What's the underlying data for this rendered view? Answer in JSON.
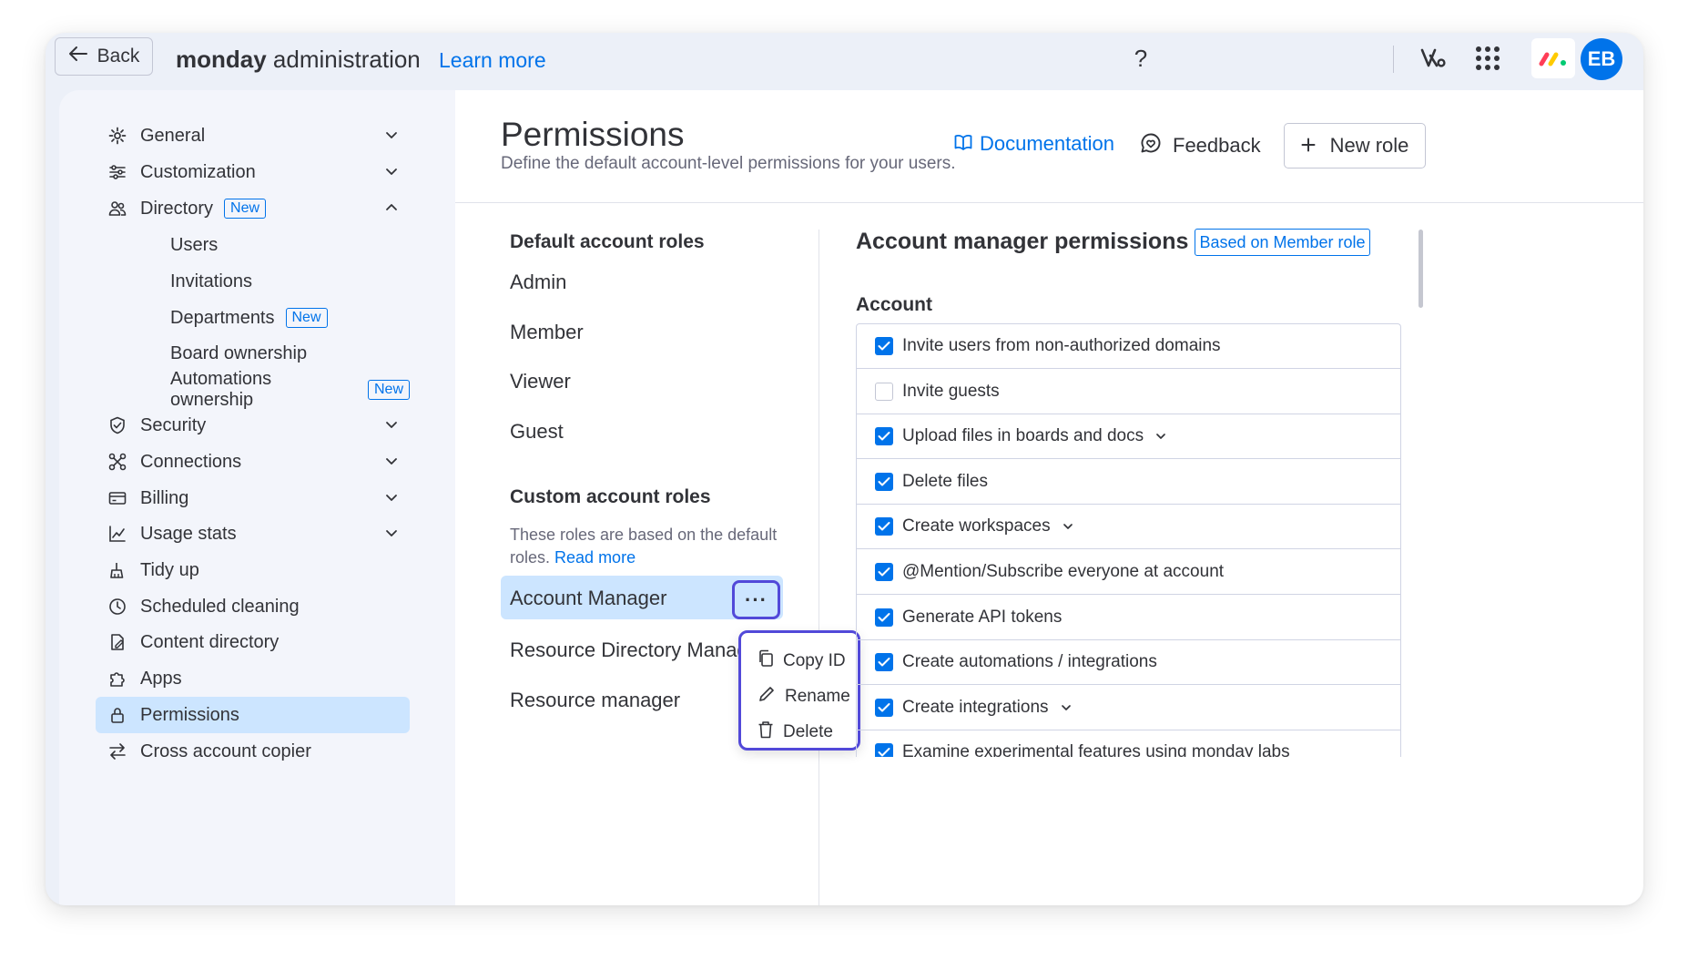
{
  "topbar": {
    "back_label": "Back",
    "app_title_bold": "monday",
    "app_title_rest": " administration",
    "learn_more": "Learn more",
    "help_glyph": "?",
    "avatar_initials": "EB"
  },
  "sidebar": {
    "badge_new": "New",
    "items": [
      {
        "label": "General",
        "icon": "gear-icon"
      },
      {
        "label": "Customization",
        "icon": "sliders-icon"
      },
      {
        "label": "Directory",
        "icon": "people-icon"
      },
      {
        "label": "Users"
      },
      {
        "label": "Invitations"
      },
      {
        "label": "Departments"
      },
      {
        "label": "Board ownership"
      },
      {
        "label": "Automations ownership"
      },
      {
        "label": "Security",
        "icon": "shield-icon"
      },
      {
        "label": "Connections",
        "icon": "connections-icon"
      },
      {
        "label": "Billing",
        "icon": "billing-icon"
      },
      {
        "label": "Usage stats",
        "icon": "chart-icon"
      },
      {
        "label": "Tidy up",
        "icon": "broom-icon"
      },
      {
        "label": "Scheduled cleaning",
        "icon": "clock-icon"
      },
      {
        "label": "Content directory",
        "icon": "content-icon"
      },
      {
        "label": "Apps",
        "icon": "puzzle-icon"
      },
      {
        "label": "Permissions",
        "icon": "lock-icon"
      },
      {
        "label": "Cross account copier",
        "icon": "copier-icon"
      }
    ]
  },
  "header": {
    "title": "Permissions",
    "subtitle": "Define the default account-level permissions for your users.",
    "documentation": "Documentation",
    "feedback": "Feedback",
    "new_role": "New role"
  },
  "roles": {
    "default_heading": "Default account roles",
    "default_roles": [
      "Admin",
      "Member",
      "Viewer",
      "Guest"
    ],
    "custom_heading": "Custom account roles",
    "custom_desc": "These roles are based on the default roles.",
    "read_more": "Read more",
    "custom_roles": [
      "Account Manager",
      "Resource Directory Manager",
      "Resource manager"
    ],
    "more_glyph": "···"
  },
  "context_menu": {
    "items": [
      {
        "label": "Copy ID",
        "icon": "copy-icon"
      },
      {
        "label": "Rename",
        "icon": "pencil-icon"
      },
      {
        "label": "Delete",
        "icon": "trash-icon"
      }
    ]
  },
  "permissions": {
    "title": "Account manager permissions",
    "based_on": "Based on Member role",
    "section": "Account",
    "rows": [
      {
        "label": "Invite users from non-authorized domains",
        "checked": true,
        "expandable": false
      },
      {
        "label": "Invite guests",
        "checked": false,
        "expandable": false
      },
      {
        "label": "Upload files in boards and docs",
        "checked": true,
        "expandable": true
      },
      {
        "label": "Delete files",
        "checked": true,
        "expandable": false
      },
      {
        "label": "Create workspaces",
        "checked": true,
        "expandable": true
      },
      {
        "label": "@Mention/Subscribe everyone at account",
        "checked": true,
        "expandable": false
      },
      {
        "label": "Generate API tokens",
        "checked": true,
        "expandable": false
      },
      {
        "label": "Create automations / integrations",
        "checked": true,
        "expandable": false
      },
      {
        "label": "Create integrations",
        "checked": true,
        "expandable": true
      },
      {
        "label": "Examine experimental features using monday labs",
        "checked": true,
        "expandable": false
      }
    ]
  },
  "colors": {
    "accent": "#0073ea",
    "selected_bg": "#cce5ff",
    "highlight_border": "#5249d9"
  }
}
